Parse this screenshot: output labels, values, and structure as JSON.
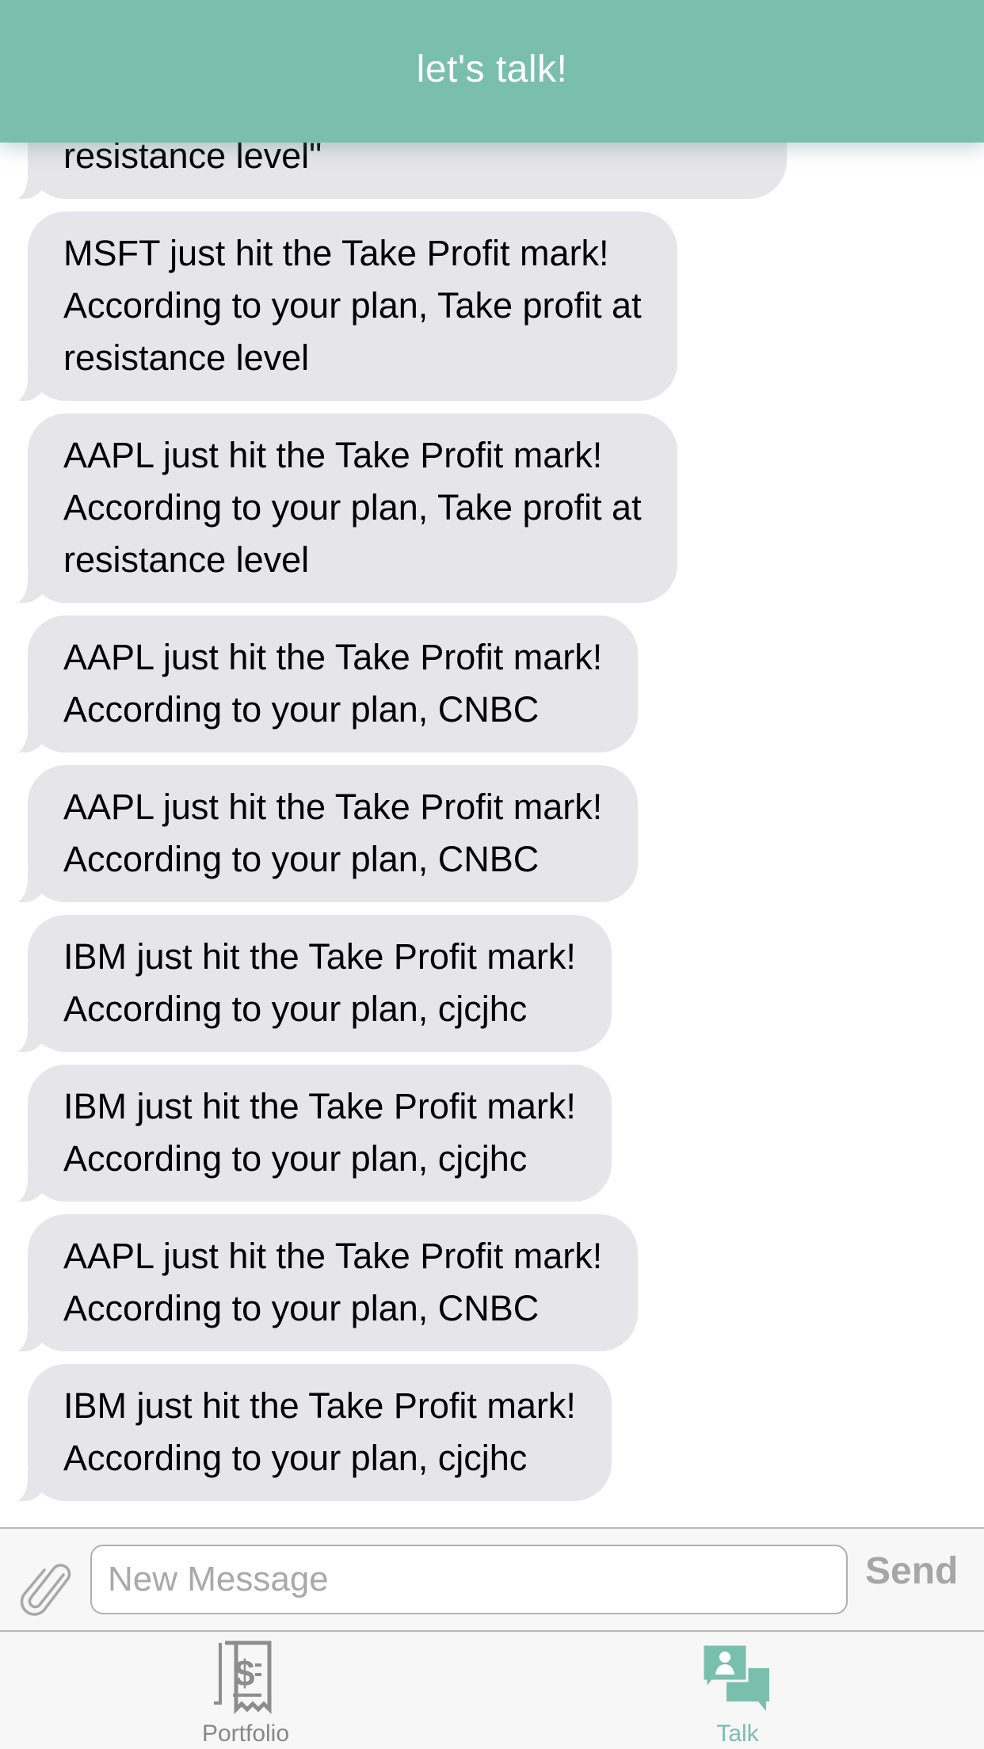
{
  "header": {
    "title": "let's talk!"
  },
  "colors": {
    "accent": "#7abfad",
    "bubble": "#e6e5ea",
    "inactive_tab": "#888888"
  },
  "messages": [
    {
      "lines": [
        "resistance level\""
      ]
    },
    {
      "lines": [
        "MSFT just hit the Take Profit mark!",
        "According to your plan, Take profit at",
        "resistance level"
      ]
    },
    {
      "lines": [
        "AAPL just hit the Take Profit mark!",
        "According to your plan, Take profit at",
        "resistance level"
      ]
    },
    {
      "lines": [
        "AAPL just hit the Take Profit mark!",
        "According to your plan, CNBC"
      ]
    },
    {
      "lines": [
        "AAPL just hit the Take Profit mark!",
        "According to your plan, CNBC"
      ]
    },
    {
      "lines": [
        "IBM just hit the Take Profit mark!",
        "According to your plan, cjcjhc"
      ]
    },
    {
      "lines": [
        "IBM just hit the Take Profit mark!",
        "According to your plan, cjcjhc"
      ]
    },
    {
      "lines": [
        "AAPL just hit the Take Profit mark!",
        "According to your plan, CNBC"
      ]
    },
    {
      "lines": [
        "IBM just hit the Take Profit mark!",
        "According to your plan, cjcjhc"
      ]
    }
  ],
  "composer": {
    "placeholder": "New Message",
    "value": "",
    "send_label": "Send",
    "attach_icon": "paperclip-icon"
  },
  "tabs": [
    {
      "label": "Portfolio",
      "icon": "receipt-dollar-icon",
      "active": false
    },
    {
      "label": "Talk",
      "icon": "chat-bubbles-icon",
      "active": true
    }
  ]
}
